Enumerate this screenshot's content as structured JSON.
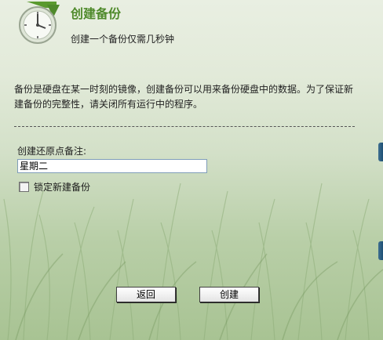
{
  "header": {
    "title": "创建备份",
    "subtitle": "创建一个备份仅需几秒钟"
  },
  "description": "备份是硬盘在某一时刻的镜像，创建备份可以用来备份硬盘中的数据。为了保证新建备份的完整性，请关闭所有运行中的程序。",
  "form": {
    "note_label": "创建还原点备注:",
    "note_value": "星期二",
    "lock_label": "锁定新建备份",
    "lock_checked": false
  },
  "buttons": {
    "back": "返回",
    "create": "创建"
  },
  "colors": {
    "title": "#4f8a2b",
    "accent_tab": "#2a5c80"
  },
  "icons": {
    "header": "clock-backup-icon",
    "side_tabs": "side-handle-icon"
  }
}
